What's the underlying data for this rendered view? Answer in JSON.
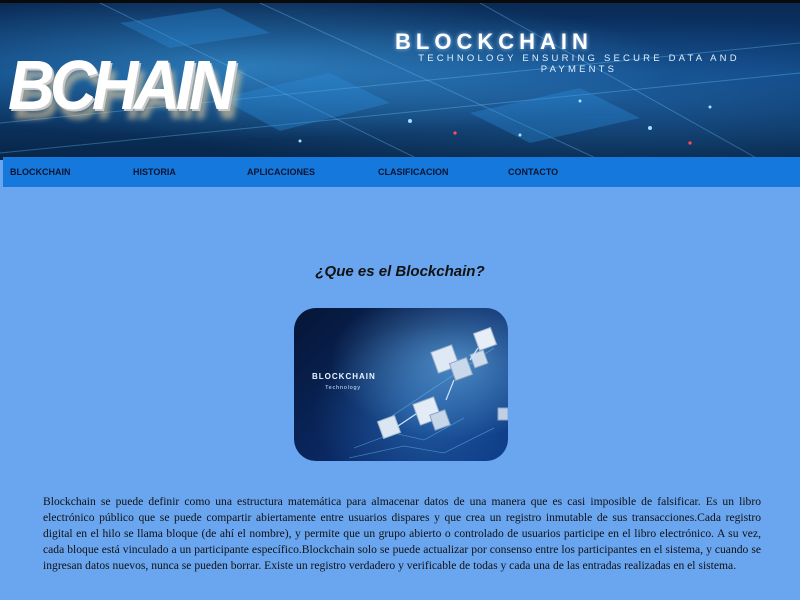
{
  "banner": {
    "brand": "BCHAIN",
    "hero_title": "BLOCKCHAIN",
    "hero_subtitle": "TECHNOLOGY ENSURING SECURE DATA AND PAYMENTS"
  },
  "nav": {
    "items": [
      "BLOCKCHAIN",
      "HISTORIA",
      "APLICACIONES",
      "CLASIFICACION",
      "CONTACTO"
    ]
  },
  "main": {
    "title": "¿Que es el Blockchain?",
    "figure": {
      "logo_text": "BLOCKCHAIN",
      "logo_sub": "Technology"
    },
    "paragraph": "Blockchain se puede definir como una estructura matemática para almacenar datos de una manera que es casi imposible de falsificar. Es un libro electrónico público que se puede compartir abiertamente entre usuarios dispares y que crea un registro inmutable de sus transacciones.Cada registro digital en el hilo se llama bloque (de ahí el nombre), y permite que un grupo abierto o controlado de usuarios participe en el libro electrónico. A su vez, cada bloque está vinculado a un participante específico.Blockchain solo se puede actualizar por consenso entre los participantes en el sistema, y cuando se ingresan datos nuevos, nunca se pueden borrar. Existe un registro verdadero y verificable de todas y cada una de las entradas realizadas en el sistema."
  },
  "colors": {
    "page_background": "#6aa6f0",
    "nav_background": "#1578dc",
    "banner_dark": "#0a2a55"
  }
}
